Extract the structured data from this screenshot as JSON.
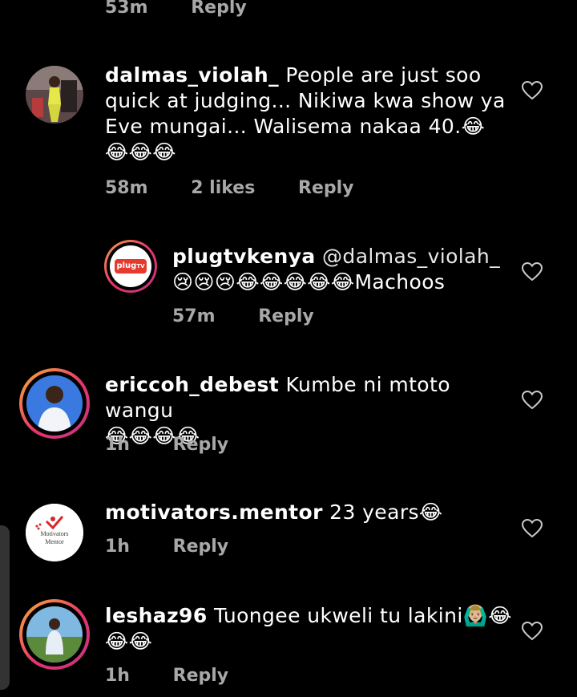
{
  "comments": [
    {
      "id": "top",
      "time": "53m",
      "reply": "Reply"
    },
    {
      "id": "dalmas",
      "username": "dalmas_violah_",
      "text_line1": " People are just soo",
      "text_line2": "quick at judging... Nikiwa kwa show ya",
      "text_line3": "Eve mungai... Walisema nakaa 40.😂",
      "text_line4": "😂😂😂",
      "time": "58m",
      "likes": "2 likes",
      "reply": "Reply"
    },
    {
      "id": "plugtv",
      "username": "plugtvkenya",
      "mention": " @dalmas_violah_",
      "text_line2": "😢😢😢😂😂😂😂😂Machoos",
      "avatar_text": "plug",
      "avatar_tv": "TV",
      "time": "57m",
      "reply": "Reply"
    },
    {
      "id": "ericcoh",
      "username": "ericcoh_debest",
      "text_line1": " Kumbe ni mtoto wangu",
      "text_line2": "😂😂😂😂",
      "time": "1h",
      "reply": "Reply"
    },
    {
      "id": "motivators",
      "username": "motivators.mentor",
      "text_line1": " 23 years😂",
      "avatar_line1": "Motivators",
      "avatar_line2": "Mentor",
      "time": "1h",
      "reply": "Reply"
    },
    {
      "id": "leshaz",
      "username": "leshaz96",
      "text_line1": " Tuongee ukweli tu lakini🙆🏼‍♂️😂",
      "text_line2": "😂😂",
      "time": "1h",
      "reply": "Reply"
    }
  ]
}
